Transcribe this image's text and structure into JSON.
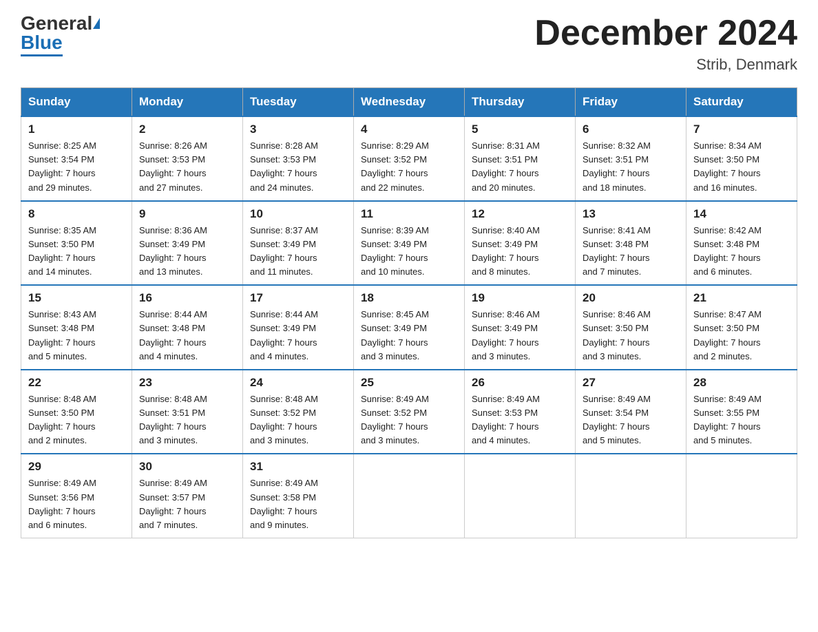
{
  "header": {
    "logo_general": "General",
    "logo_blue": "Blue",
    "title": "December 2024",
    "location": "Strib, Denmark"
  },
  "days_of_week": [
    "Sunday",
    "Monday",
    "Tuesday",
    "Wednesday",
    "Thursday",
    "Friday",
    "Saturday"
  ],
  "weeks": [
    [
      {
        "day": "1",
        "sunrise": "8:25 AM",
        "sunset": "3:54 PM",
        "daylight": "7 hours and 29 minutes."
      },
      {
        "day": "2",
        "sunrise": "8:26 AM",
        "sunset": "3:53 PM",
        "daylight": "7 hours and 27 minutes."
      },
      {
        "day": "3",
        "sunrise": "8:28 AM",
        "sunset": "3:53 PM",
        "daylight": "7 hours and 24 minutes."
      },
      {
        "day": "4",
        "sunrise": "8:29 AM",
        "sunset": "3:52 PM",
        "daylight": "7 hours and 22 minutes."
      },
      {
        "day": "5",
        "sunrise": "8:31 AM",
        "sunset": "3:51 PM",
        "daylight": "7 hours and 20 minutes."
      },
      {
        "day": "6",
        "sunrise": "8:32 AM",
        "sunset": "3:51 PM",
        "daylight": "7 hours and 18 minutes."
      },
      {
        "day": "7",
        "sunrise": "8:34 AM",
        "sunset": "3:50 PM",
        "daylight": "7 hours and 16 minutes."
      }
    ],
    [
      {
        "day": "8",
        "sunrise": "8:35 AM",
        "sunset": "3:50 PM",
        "daylight": "7 hours and 14 minutes."
      },
      {
        "day": "9",
        "sunrise": "8:36 AM",
        "sunset": "3:49 PM",
        "daylight": "7 hours and 13 minutes."
      },
      {
        "day": "10",
        "sunrise": "8:37 AM",
        "sunset": "3:49 PM",
        "daylight": "7 hours and 11 minutes."
      },
      {
        "day": "11",
        "sunrise": "8:39 AM",
        "sunset": "3:49 PM",
        "daylight": "7 hours and 10 minutes."
      },
      {
        "day": "12",
        "sunrise": "8:40 AM",
        "sunset": "3:49 PM",
        "daylight": "7 hours and 8 minutes."
      },
      {
        "day": "13",
        "sunrise": "8:41 AM",
        "sunset": "3:48 PM",
        "daylight": "7 hours and 7 minutes."
      },
      {
        "day": "14",
        "sunrise": "8:42 AM",
        "sunset": "3:48 PM",
        "daylight": "7 hours and 6 minutes."
      }
    ],
    [
      {
        "day": "15",
        "sunrise": "8:43 AM",
        "sunset": "3:48 PM",
        "daylight": "7 hours and 5 minutes."
      },
      {
        "day": "16",
        "sunrise": "8:44 AM",
        "sunset": "3:48 PM",
        "daylight": "7 hours and 4 minutes."
      },
      {
        "day": "17",
        "sunrise": "8:44 AM",
        "sunset": "3:49 PM",
        "daylight": "7 hours and 4 minutes."
      },
      {
        "day": "18",
        "sunrise": "8:45 AM",
        "sunset": "3:49 PM",
        "daylight": "7 hours and 3 minutes."
      },
      {
        "day": "19",
        "sunrise": "8:46 AM",
        "sunset": "3:49 PM",
        "daylight": "7 hours and 3 minutes."
      },
      {
        "day": "20",
        "sunrise": "8:46 AM",
        "sunset": "3:50 PM",
        "daylight": "7 hours and 3 minutes."
      },
      {
        "day": "21",
        "sunrise": "8:47 AM",
        "sunset": "3:50 PM",
        "daylight": "7 hours and 2 minutes."
      }
    ],
    [
      {
        "day": "22",
        "sunrise": "8:48 AM",
        "sunset": "3:50 PM",
        "daylight": "7 hours and 2 minutes."
      },
      {
        "day": "23",
        "sunrise": "8:48 AM",
        "sunset": "3:51 PM",
        "daylight": "7 hours and 3 minutes."
      },
      {
        "day": "24",
        "sunrise": "8:48 AM",
        "sunset": "3:52 PM",
        "daylight": "7 hours and 3 minutes."
      },
      {
        "day": "25",
        "sunrise": "8:49 AM",
        "sunset": "3:52 PM",
        "daylight": "7 hours and 3 minutes."
      },
      {
        "day": "26",
        "sunrise": "8:49 AM",
        "sunset": "3:53 PM",
        "daylight": "7 hours and 4 minutes."
      },
      {
        "day": "27",
        "sunrise": "8:49 AM",
        "sunset": "3:54 PM",
        "daylight": "7 hours and 5 minutes."
      },
      {
        "day": "28",
        "sunrise": "8:49 AM",
        "sunset": "3:55 PM",
        "daylight": "7 hours and 5 minutes."
      }
    ],
    [
      {
        "day": "29",
        "sunrise": "8:49 AM",
        "sunset": "3:56 PM",
        "daylight": "7 hours and 6 minutes."
      },
      {
        "day": "30",
        "sunrise": "8:49 AM",
        "sunset": "3:57 PM",
        "daylight": "7 hours and 7 minutes."
      },
      {
        "day": "31",
        "sunrise": "8:49 AM",
        "sunset": "3:58 PM",
        "daylight": "7 hours and 9 minutes."
      },
      null,
      null,
      null,
      null
    ]
  ],
  "colors": {
    "header_bg": "#2576b9",
    "header_text": "#ffffff",
    "border": "#aaaaaa",
    "cell_border_top": "#2576b9"
  }
}
